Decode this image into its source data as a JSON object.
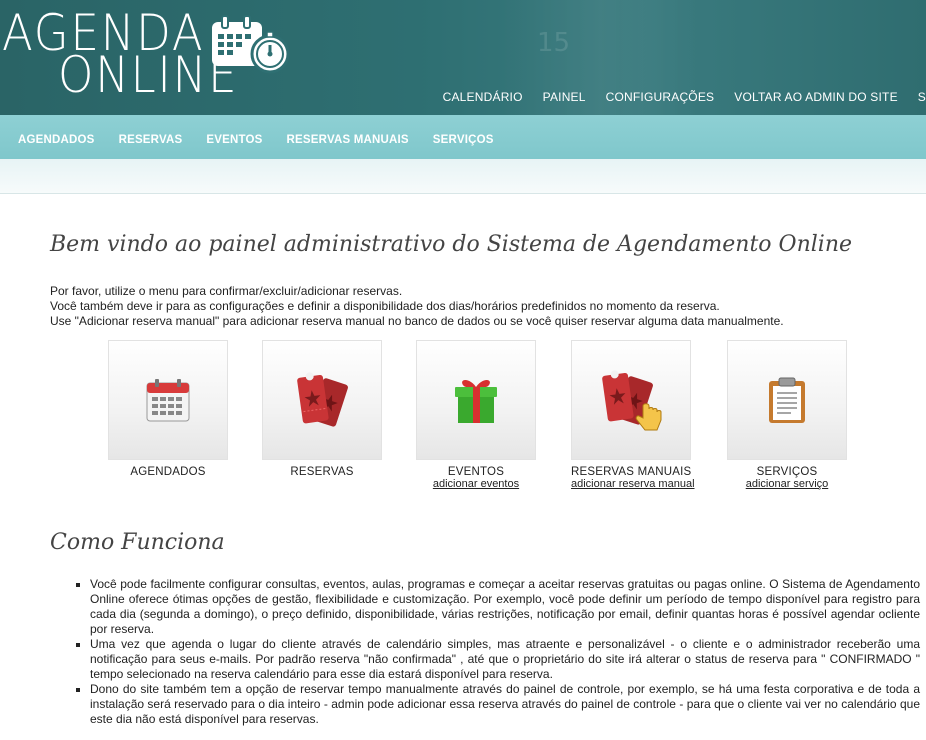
{
  "header": {
    "logo_line1": "AGENDA",
    "logo_line2": "ONLINE",
    "nav": [
      "CALENDÁRIO",
      "PAINEL",
      "CONFIGURAÇÕES",
      "VOLTAR AO ADMIN DO SITE",
      "S"
    ]
  },
  "subnav": [
    "AGENDADOS",
    "RESERVAS",
    "EVENTOS",
    "RESERVAS MANUAIS",
    "SERVIÇOS"
  ],
  "main": {
    "welcome_title": "Bem vindo ao painel administrativo do Sistema de Agendamento Online",
    "intro": [
      "Por favor, utilize o menu para confirmar/excluir/adicionar reservas.",
      "Você também deve ir para as configurações e definir a disponibilidade dos dias/horários predefinidos no momento da reserva.",
      "Use \"Adicionar reserva manual\" para adicionar reserva manual no banco de dados ou se você quiser reservar alguma data manualmente."
    ],
    "tiles": [
      {
        "label": "AGENDADOS",
        "link": "",
        "icon": "calendar-icon"
      },
      {
        "label": "RESERVAS",
        "link": "",
        "icon": "tickets-icon"
      },
      {
        "label": "EVENTOS",
        "link": "adicionar eventos",
        "icon": "gift-icon"
      },
      {
        "label": "RESERVAS MANUAIS",
        "link": "adicionar reserva manual",
        "icon": "tickets-hand-icon"
      },
      {
        "label": "SERVIÇOS",
        "link": "adicionar serviço",
        "icon": "clipboard-icon"
      }
    ],
    "how_title": "Como Funciona",
    "how_items": [
      "Você pode facilmente configurar consultas, eventos, aulas, programas e começar a aceitar reservas gratuitas ou pagas online. O Sistema de Agendamento Online oferece ótimas opções de gestão, flexibilidade e customização. Por exemplo, você pode definir um período de tempo disponível para registro para cada dia (segunda a domingo), o preço definido, disponibilidade, várias restrições, notificação por email, definir quantas horas é possível agendar ocliente por reserva.",
      "Uma vez que agenda o lugar do cliente através de calendário simples, mas atraente e personalizável - o cliente e o administrador receberão uma notificação para seus e-mails. Por padrão reserva \"não confirmada\" , até que o proprietário do site irá alterar o status de reserva para \" CONFIRMADO \" tempo selecionado na reserva calendário para esse dia estará disponível para reserva.",
      "Dono do site também tem a opção de reservar tempo manualmente através do painel de controle, por exemplo, se há uma festa corporativa e de toda a instalação será reservado para o dia inteiro - admin pode adicionar essa reserva através do painel de controle - para que o cliente vai ver no calendário que este dia não está disponível para reservas."
    ]
  },
  "colors": {
    "header_bg": "#2e6f72",
    "subnav_bg": "#8ed0d4",
    "text": "#222222"
  }
}
